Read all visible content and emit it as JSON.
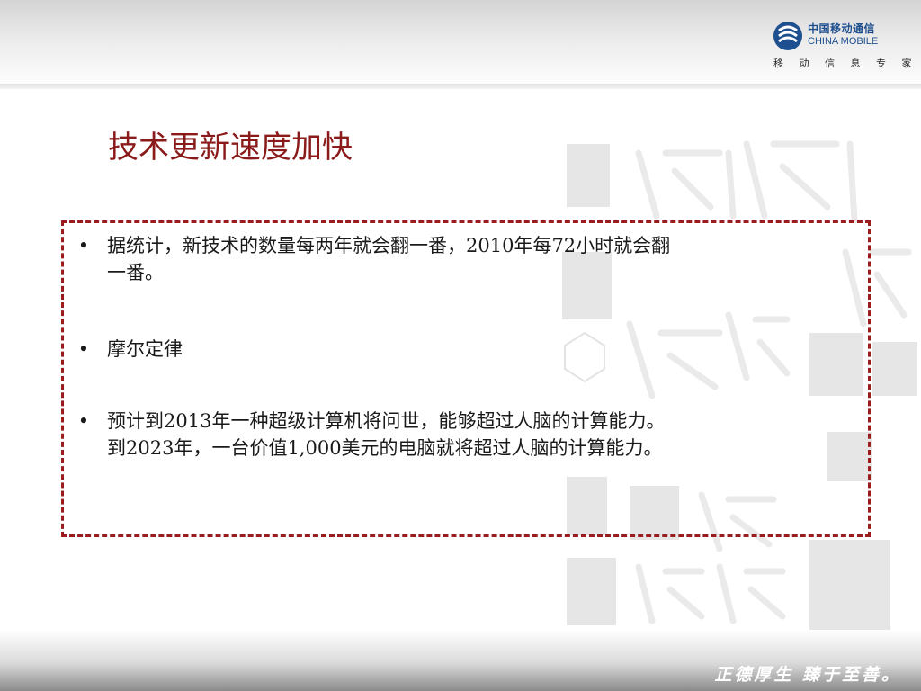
{
  "header": {
    "logo_cn": "中国移动通信",
    "logo_en": "CHINA MOBILE",
    "tagline": "移 动 信 息 专 家"
  },
  "slide": {
    "title": "技术更新速度加快",
    "bullets": [
      {
        "marker": "•",
        "line1": "据统计，新技术的数量每两年就会翻一番，2010年每72小时就会翻",
        "line2": "一番。"
      },
      {
        "marker": "•",
        "line1": "摩尔定律",
        "line2": ""
      },
      {
        "marker": "•",
        "line1": "预计到2013年一种超级计算机将问世，能够超过人脑的计算能力。",
        "line2": "到2023年，一台价值1,000美元的电脑就将超过人脑的计算能力。"
      }
    ]
  },
  "footer": {
    "motto": "正德厚生 臻于至善。"
  },
  "colors": {
    "title": "#8b1a1a",
    "border": "#9b1c1c",
    "brand": "#1e4f8f"
  }
}
